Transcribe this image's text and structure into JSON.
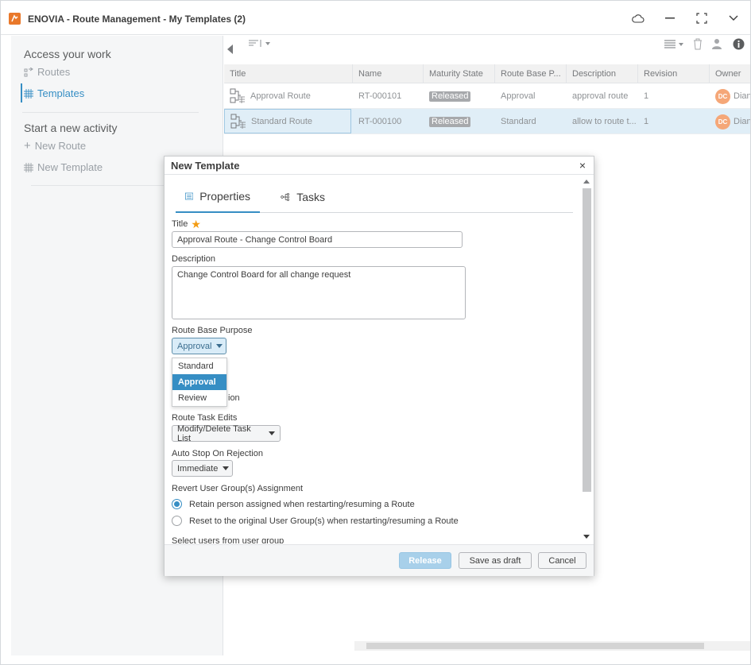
{
  "window": {
    "title": "ENOVIA - Route Management - My Templates (2)"
  },
  "left_panel": {
    "section_access": "Access your work",
    "routes": "Routes",
    "templates": "Templates",
    "section_start": "Start a new activity",
    "new_route": "New Route",
    "new_template": "New Template"
  },
  "grid": {
    "columns": [
      "Title",
      "Name",
      "Maturity State",
      "Route Base P...",
      "Description",
      "Revision",
      "Owner"
    ],
    "rows": [
      {
        "title": "Approval Route",
        "name": "RT-000101",
        "state": "Released",
        "purpose": "Approval",
        "description": "approval route",
        "revision": "1",
        "owner_initials": "DC",
        "owner": "Dian"
      },
      {
        "title": "Standard Route",
        "name": "RT-000100",
        "state": "Released",
        "purpose": "Standard",
        "description": "allow to route t...",
        "revision": "1",
        "owner_initials": "DC",
        "owner": "Dian"
      }
    ]
  },
  "dialog": {
    "title": "New Template",
    "close": "×",
    "tabs": [
      "Properties",
      "Tasks"
    ],
    "title_label": "Title",
    "title_value": "Approval Route - Change Control Board",
    "description_label": "Description",
    "description_value": "Change Control Board for all change request",
    "purpose_label": "Route Base Purpose",
    "purpose_value": "Approval",
    "purpose_options": [
      "Standard",
      "Approval",
      "Review"
    ],
    "hidden_label_tail": "ion",
    "task_edits_label": "Route Task Edits",
    "task_edits_value": "Modify/Delete Task List",
    "auto_stop_label": "Auto Stop On Rejection",
    "auto_stop_value": "Immediate",
    "revert_label": "Revert User Group(s) Assignment",
    "revert_options": [
      "Retain person assigned when restarting/resuming a Route",
      "Reset to the original User Group(s) when restarting/resuming a Route"
    ],
    "select_users_label": "Select users from user group",
    "buttons": {
      "release": "Release",
      "save_draft": "Save as draft",
      "cancel": "Cancel"
    }
  },
  "colors": {
    "accent": "#368ec4",
    "brand": "#e9782a",
    "badge": "#a7a9ac",
    "avatar": "#f5a778"
  }
}
